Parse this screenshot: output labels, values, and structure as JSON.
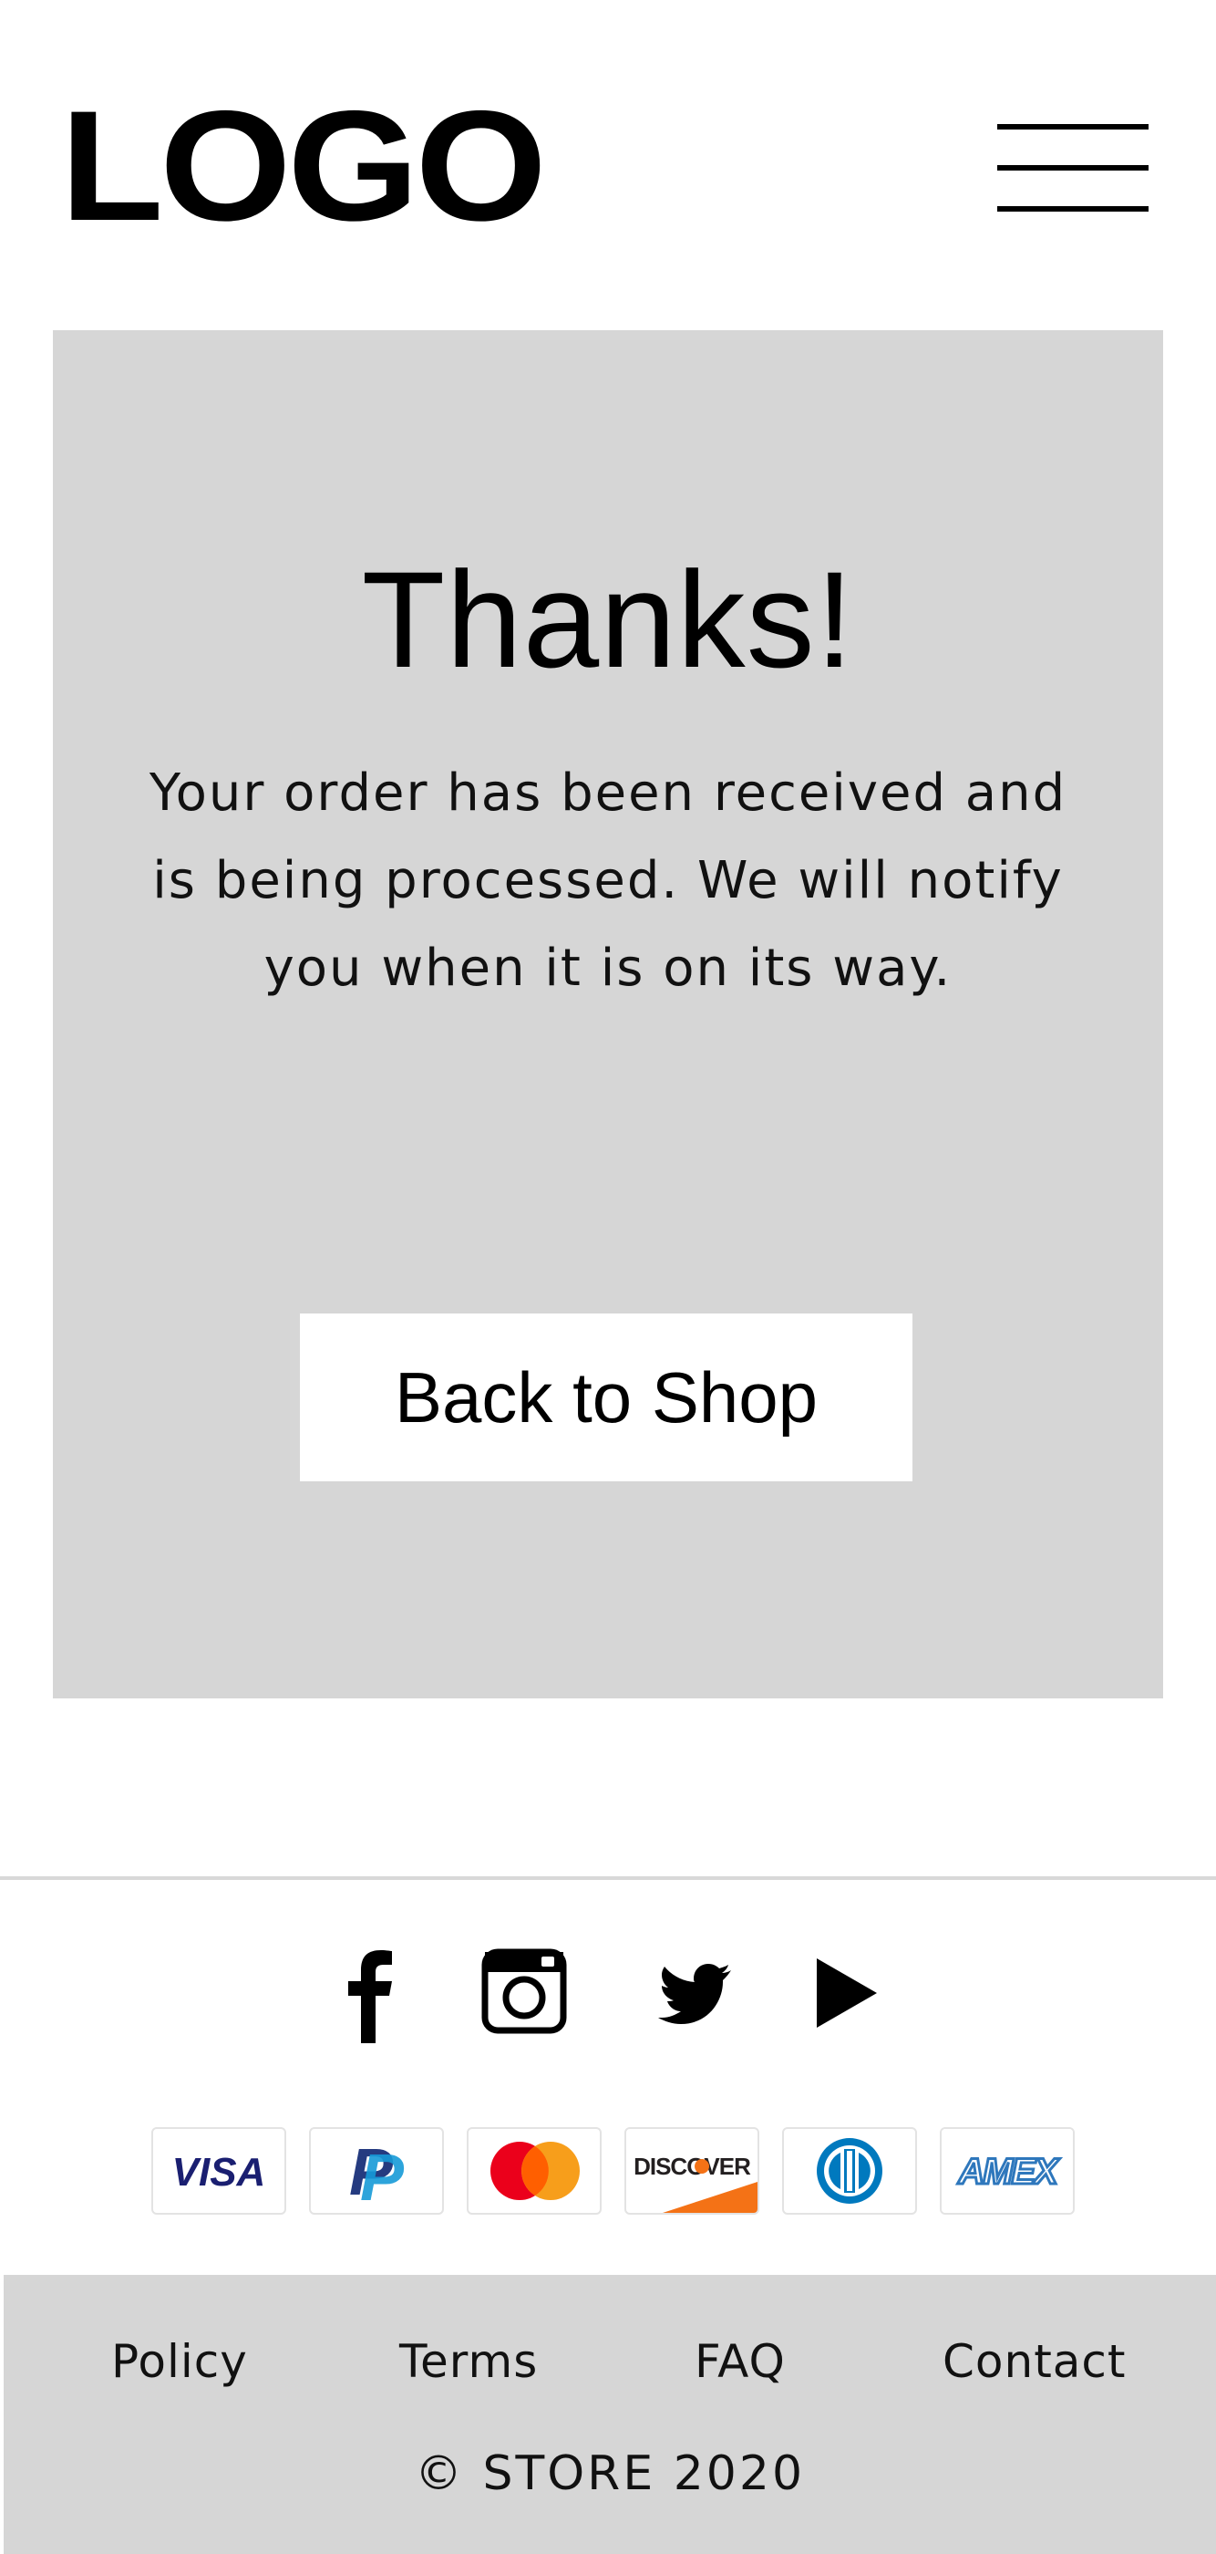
{
  "header": {
    "logo": "LOGO",
    "menu_icon": "hamburger-menu-icon"
  },
  "confirmation": {
    "title": "Thanks!",
    "message": "Your order has been received and is being processed. We will notify you when it is on its way.",
    "back_button": "Back to Shop"
  },
  "social": [
    {
      "name": "facebook",
      "icon": "facebook-icon"
    },
    {
      "name": "instagram",
      "icon": "instagram-icon"
    },
    {
      "name": "twitter",
      "icon": "twitter-icon"
    },
    {
      "name": "youtube",
      "icon": "play-icon"
    }
  ],
  "payments": {
    "visa": "VISA",
    "paypal": "P",
    "mastercard": "mastercard-logo",
    "discover": "DISCOVER",
    "diners": "diners-club-logo",
    "amex": "AMEX"
  },
  "footer": {
    "links": [
      "Policy",
      "Terms",
      "FAQ",
      "Contact"
    ],
    "copyright": "© STORE 2020"
  },
  "colors": {
    "card_background": "#d6d6d6",
    "button_background": "#ffffff",
    "text": "#000000"
  }
}
